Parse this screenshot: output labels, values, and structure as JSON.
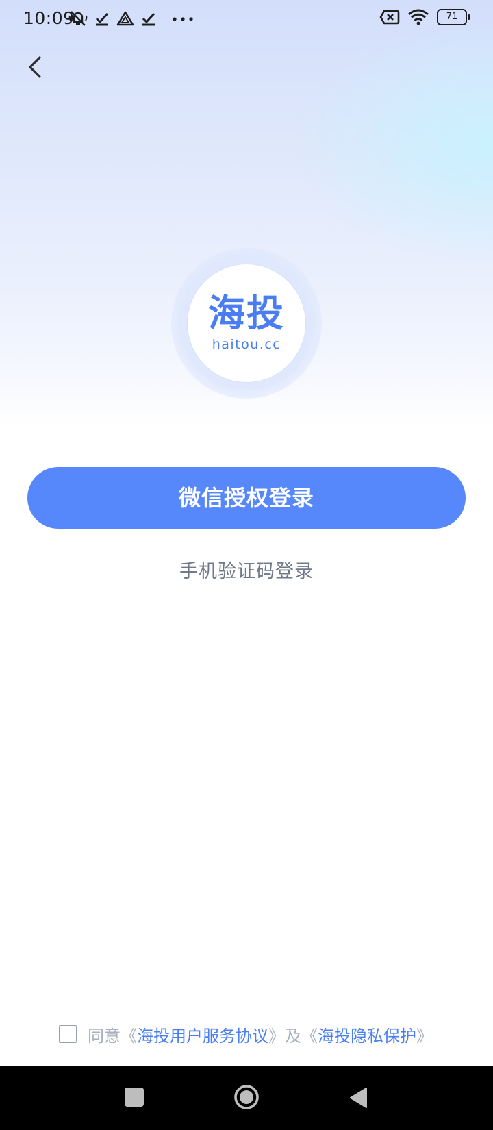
{
  "status_bar": {
    "time": "10:09",
    "battery": "71",
    "left_icons": [
      "notification-muted-icon",
      "check-download-icon",
      "drive-icon",
      "check-download-icon",
      "more-dots-icon"
    ],
    "right_icons": [
      "sim-error-icon",
      "wifi-icon",
      "battery-icon"
    ]
  },
  "header": {
    "back_icon": "chevron-left-icon"
  },
  "logo": {
    "title": "海投",
    "domain": "haitou.cc",
    "color": "#4a7df2"
  },
  "actions": {
    "wechat_login": "微信授权登录",
    "sms_login": "手机验证码登录",
    "primary_color": "#5687fb"
  },
  "agreement": {
    "prefix": "同意",
    "open_bracket_1": "《",
    "user_agreement": "海投用户服务协议",
    "close_bracket_1": "》",
    "conjunction": "及",
    "open_bracket_2": "《",
    "privacy_policy": "海投隐私保护",
    "close_bracket_2": "》",
    "checked": false
  },
  "nav_bar": {
    "items": [
      "recents-button",
      "home-button",
      "back-button"
    ]
  }
}
